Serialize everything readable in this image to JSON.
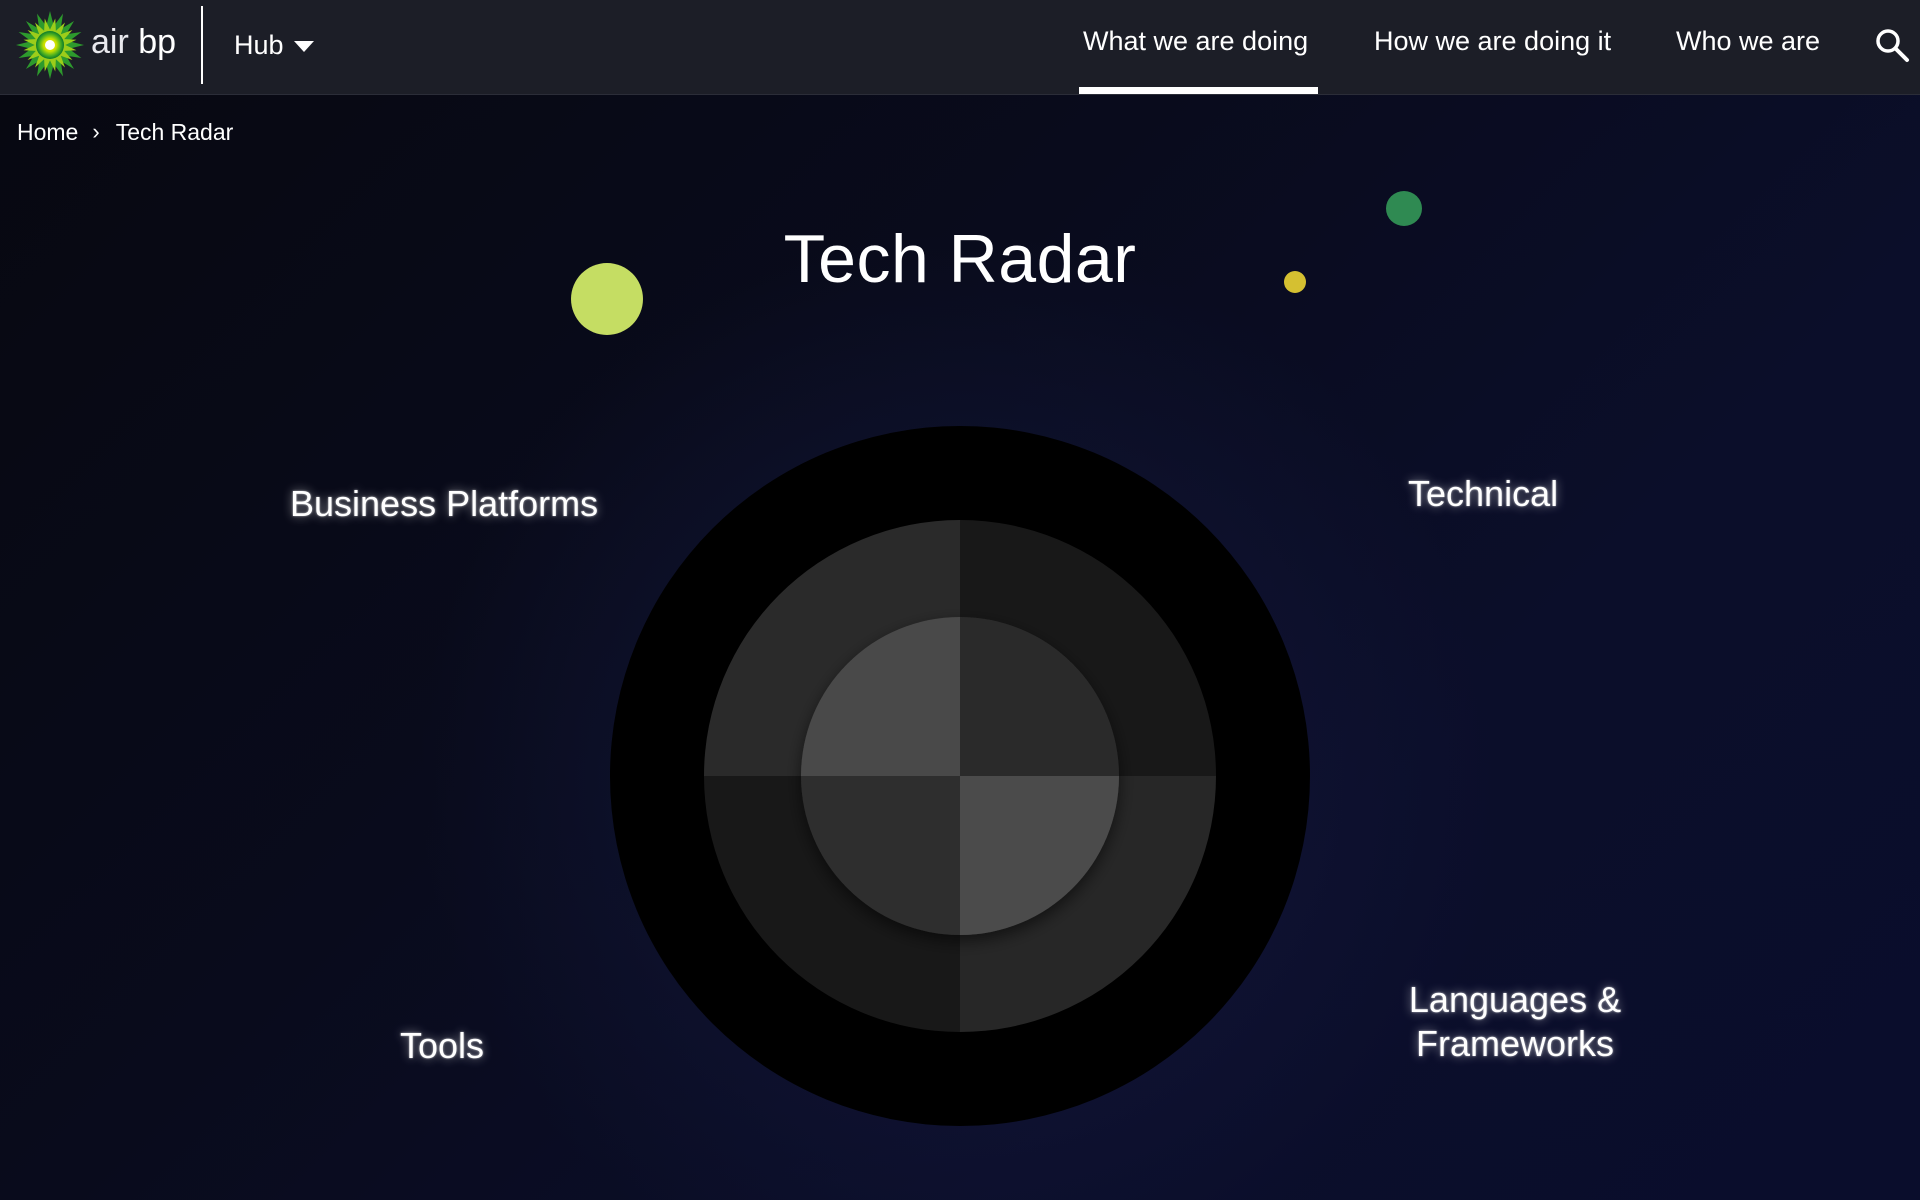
{
  "header": {
    "brand_air": "air",
    "brand_bp": "bp",
    "hub_label": "Hub",
    "nav": [
      {
        "label": "What we are doing",
        "active": true
      },
      {
        "label": "How we are doing it",
        "active": false
      },
      {
        "label": "Who we are",
        "active": false
      }
    ],
    "search_icon": "search-icon",
    "logo_icon": "bp-helios-logo-icon"
  },
  "breadcrumb": {
    "home": "Home",
    "separator": "›",
    "current": "Tech Radar"
  },
  "main": {
    "title": "Tech Radar",
    "quadrants": {
      "business_platforms": "Business Platforms",
      "technical": "Technical",
      "tools": "Tools",
      "languages_line1": "Languages &",
      "languages_line2": "Frameworks"
    }
  },
  "colors": {
    "header_bg": "#1c1e27",
    "page_bg": "#05070f",
    "blip_lime": "#c5dd63",
    "blip_green": "#2f8a52",
    "blip_yellow": "#d5c031",
    "ring_outer": "#000000",
    "ring_mid_dark": "#181818",
    "ring_mid_light": "#2a2a2a",
    "ring_inner_dark": "#2c2c2c",
    "ring_inner_light": "#4a4a4a"
  }
}
